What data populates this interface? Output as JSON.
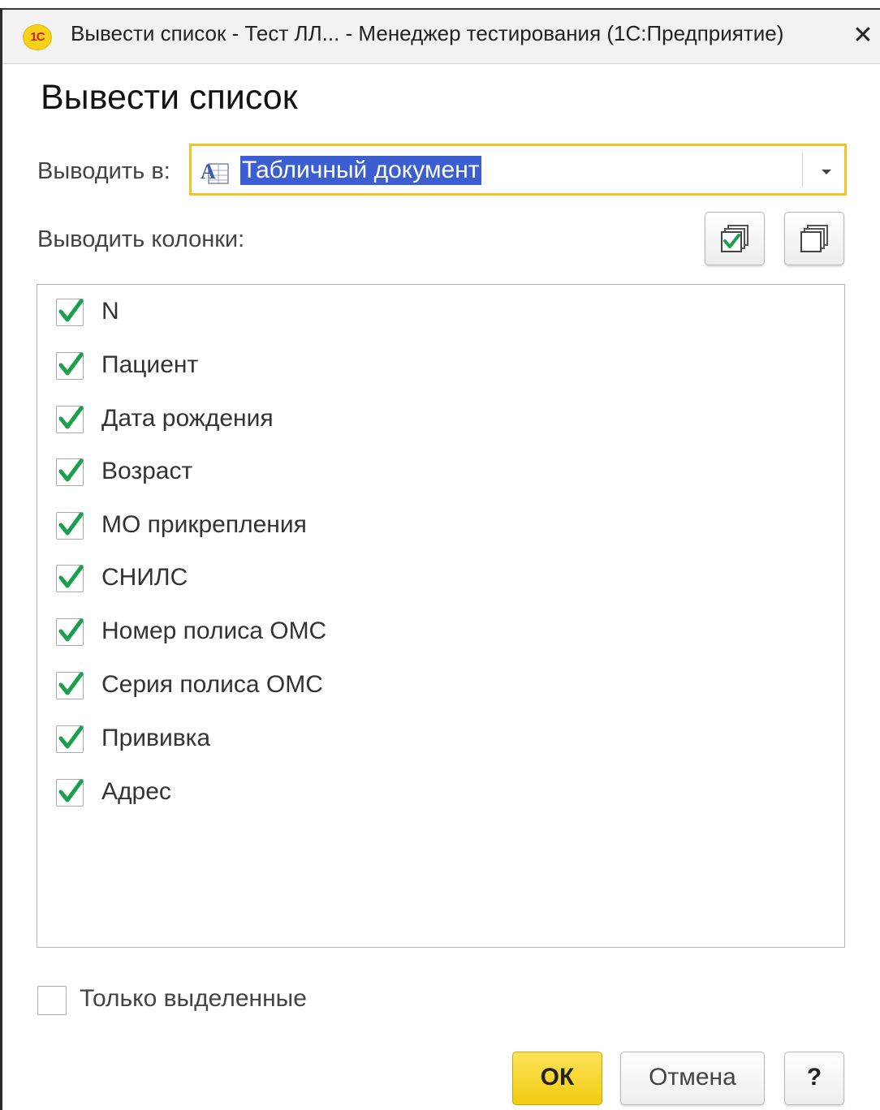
{
  "window": {
    "logo_text": "1С",
    "title": "Вывести список - Тест ЛЛ... - Менеджер тестирования (1С:Предприятие)",
    "close_glyph": "✕"
  },
  "form": {
    "title": "Вывести список",
    "output_label": "Выводить в:",
    "output_value": "Табличный документ",
    "columns_label": "Выводить колонки:",
    "check_all_icon": "check-all-icon",
    "uncheck_all_icon": "uncheck-all-icon"
  },
  "columns": [
    {
      "label": "N",
      "checked": true
    },
    {
      "label": "Пациент",
      "checked": true
    },
    {
      "label": "Дата рождения",
      "checked": true
    },
    {
      "label": "Возраст",
      "checked": true
    },
    {
      "label": "МО прикрепления",
      "checked": true
    },
    {
      "label": "СНИЛС",
      "checked": true
    },
    {
      "label": "Номер полиса ОМС",
      "checked": true
    },
    {
      "label": "Серия полиса ОМС",
      "checked": true
    },
    {
      "label": "Прививка",
      "checked": true
    },
    {
      "label": "Адрес",
      "checked": true
    }
  ],
  "only_selected": {
    "label": "Только выделенные",
    "checked": false
  },
  "buttons": {
    "ok": "ОК",
    "cancel": "Отмена",
    "help": "?"
  },
  "colors": {
    "accent_yellow": "#f2c522",
    "selection_blue": "#3b5fd1",
    "check_green": "#1aa04a"
  }
}
